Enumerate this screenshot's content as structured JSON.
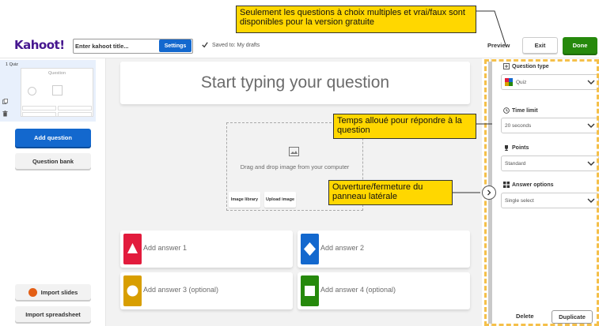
{
  "header": {
    "logo": "Kahoot!",
    "title_placeholder": "Enter kahoot title...",
    "settings_label": "Settings",
    "saved_text": "Saved to: My drafts",
    "preview_label": "Preview",
    "exit_label": "Exit",
    "done_label": "Done"
  },
  "sidebar": {
    "slide_number": "1  Quiz",
    "slide_title": "Question",
    "add_question_label": "Add question",
    "question_bank_label": "Question bank",
    "import_slides_label": "Import slides",
    "import_spreadsheet_label": "Import spreadsheet"
  },
  "editor": {
    "question_placeholder": "Start typing your question",
    "media_text": "Drag and drop image from your computer",
    "image_library_label": "Image library",
    "upload_image_label": "Upload image",
    "answers": [
      {
        "label": "Add answer 1",
        "color": "#e21b3c",
        "shape": "triangle"
      },
      {
        "label": "Add answer 2",
        "color": "#1368ce",
        "shape": "diamond"
      },
      {
        "label": "Add answer 3 (optional)",
        "color": "#d89e00",
        "shape": "circle"
      },
      {
        "label": "Add answer 4 (optional)",
        "color": "#26890c",
        "shape": "square"
      }
    ]
  },
  "panel": {
    "question_type_label": "Question type",
    "question_type_value": "Quiz",
    "time_limit_label": "Time limit",
    "time_limit_value": "20 seconds",
    "points_label": "Points",
    "points_value": "Standard",
    "answer_options_label": "Answer options",
    "answer_options_value": "Single select",
    "delete_label": "Delete",
    "duplicate_label": "Duplicate"
  },
  "callouts": {
    "free_version": "Seulement  les questions à choix multiples et vrai/faux sont disponibles pour la version gratuite",
    "time_allowed": "Temps alloué pour répondre à la question",
    "panel_toggle": "Ouverture/fermeture du panneau latérale"
  },
  "colors": {
    "brand": "#46178f",
    "primary": "#1368ce",
    "done": "#26890c",
    "callout": "#ffd700",
    "frame": "#f5c04a"
  }
}
